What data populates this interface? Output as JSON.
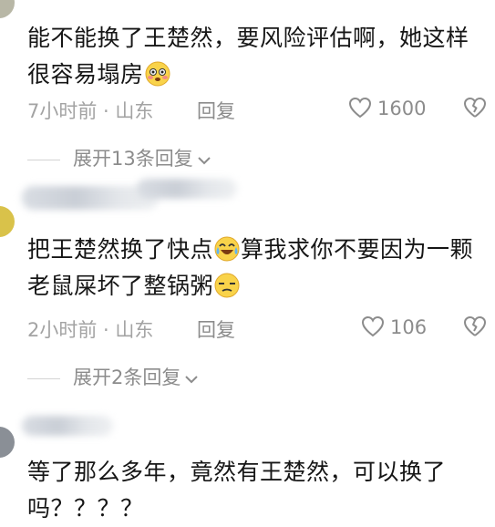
{
  "comments": [
    {
      "text_part1": "能不能换了王楚然，要风险评估啊，她这样很容易塌房",
      "emoji1": "flushed-face-emoji",
      "time_location": "7小时前 · 山东",
      "reply_label": "回复",
      "likes": "1600",
      "expand_label": "展开13条回复"
    },
    {
      "text_part1": "把王楚然换了快点",
      "emoji1": "crying-laughing-emoji",
      "text_part2": "算我求你不要因为一颗老鼠屎坏了整锅粥",
      "emoji2": "squinting-face-emoji",
      "time_location": "2小时前 · 山东",
      "reply_label": "回复",
      "likes": "106",
      "expand_label": "展开2条回复"
    },
    {
      "text_part1": "等了那么多年，竟然有王楚然，可以换了吗？？？？"
    }
  ],
  "colors": {
    "text": "#161616",
    "meta": "#a3a3a3",
    "action": "#8c8c8c"
  }
}
